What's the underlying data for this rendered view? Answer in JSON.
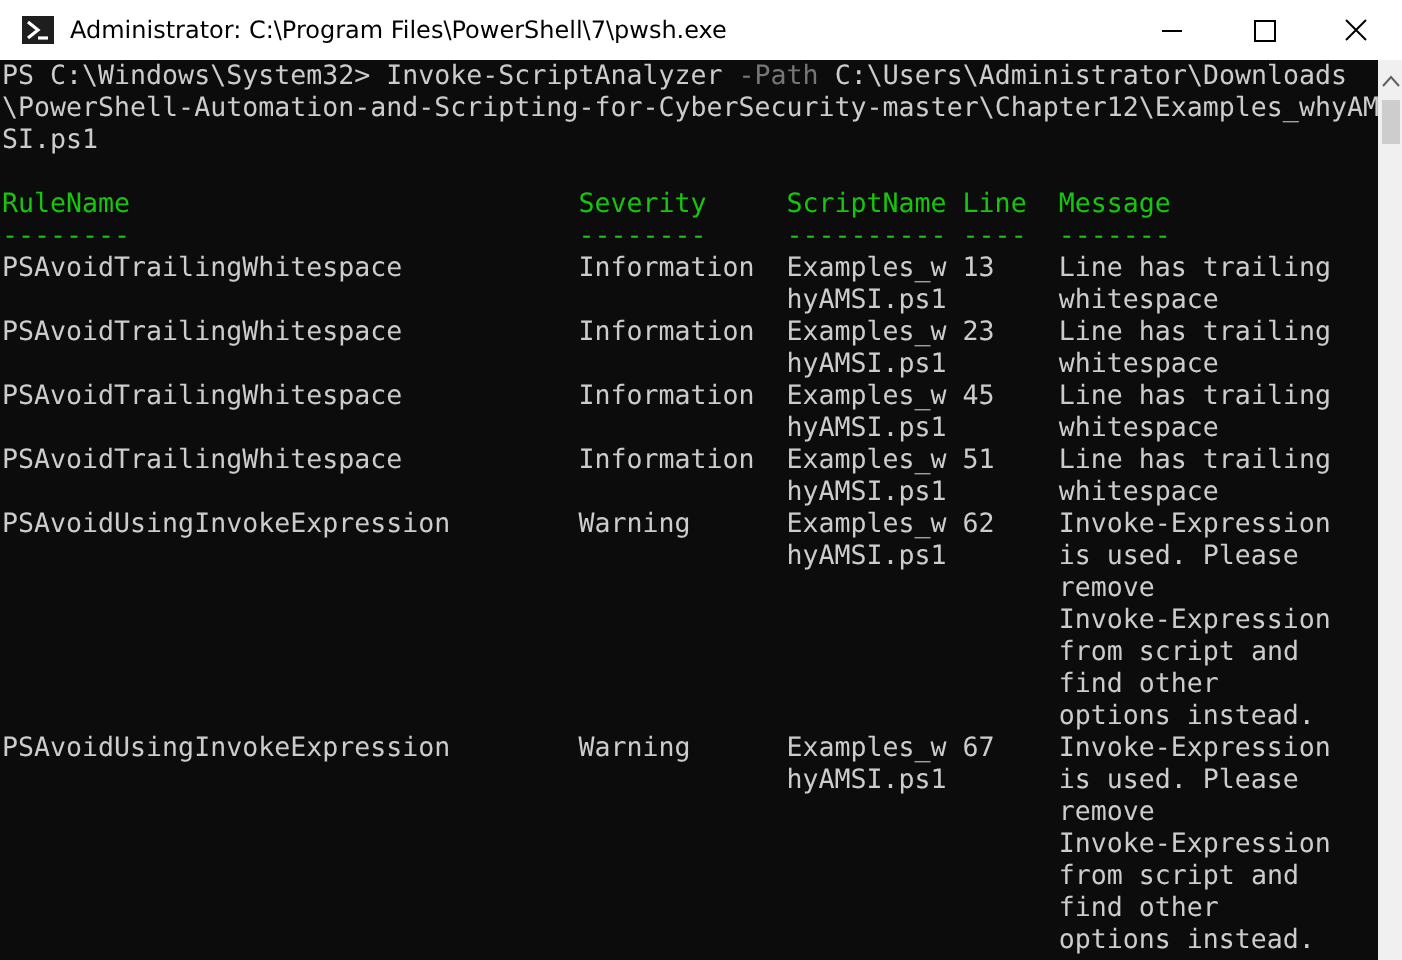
{
  "window": {
    "title": "Administrator: C:\\Program Files\\PowerShell\\7\\pwsh.exe"
  },
  "command": {
    "prompt": "PS C:\\Windows\\System32> ",
    "cmdlet": "Invoke-ScriptAnalyzer",
    "parameter": "-Path",
    "argument": "C:\\Users\\Administrator\\Downloads\\PowerShell-Automation-and-Scripting-for-CyberSecurity-master\\Chapter12\\Examples_whyAMSI.ps1"
  },
  "table": {
    "columns": [
      {
        "name": "RuleName",
        "rule": "--------"
      },
      {
        "name": "Severity",
        "rule": "--------"
      },
      {
        "name": "ScriptName",
        "rule": "----------"
      },
      {
        "name": "Line",
        "rule": "----"
      },
      {
        "name": "Message",
        "rule": "-------"
      }
    ],
    "rows": [
      {
        "rule_name": "PSAvoidTrailingWhitespace",
        "severity": "Information",
        "script_name": "Examples_whyAMSI.ps1",
        "line": "13",
        "message": "Line has trailing whitespace"
      },
      {
        "rule_name": "PSAvoidTrailingWhitespace",
        "severity": "Information",
        "script_name": "Examples_whyAMSI.ps1",
        "line": "23",
        "message": "Line has trailing whitespace"
      },
      {
        "rule_name": "PSAvoidTrailingWhitespace",
        "severity": "Information",
        "script_name": "Examples_whyAMSI.ps1",
        "line": "45",
        "message": "Line has trailing whitespace"
      },
      {
        "rule_name": "PSAvoidTrailingWhitespace",
        "severity": "Information",
        "script_name": "Examples_whyAMSI.ps1",
        "line": "51",
        "message": "Line has trailing whitespace"
      },
      {
        "rule_name": "PSAvoidUsingInvokeExpression",
        "severity": "Warning",
        "script_name": "Examples_whyAMSI.ps1",
        "line": "62",
        "message": "Invoke-Expression is used. Please remove Invoke-Expression from script and find other options instead."
      },
      {
        "rule_name": "PSAvoidUsingInvokeExpression",
        "severity": "Warning",
        "script_name": "Examples_whyAMSI.ps1",
        "line": "67",
        "message": "Invoke-Expression is used. Please remove Invoke-Expression from script and find other options instead."
      }
    ]
  }
}
